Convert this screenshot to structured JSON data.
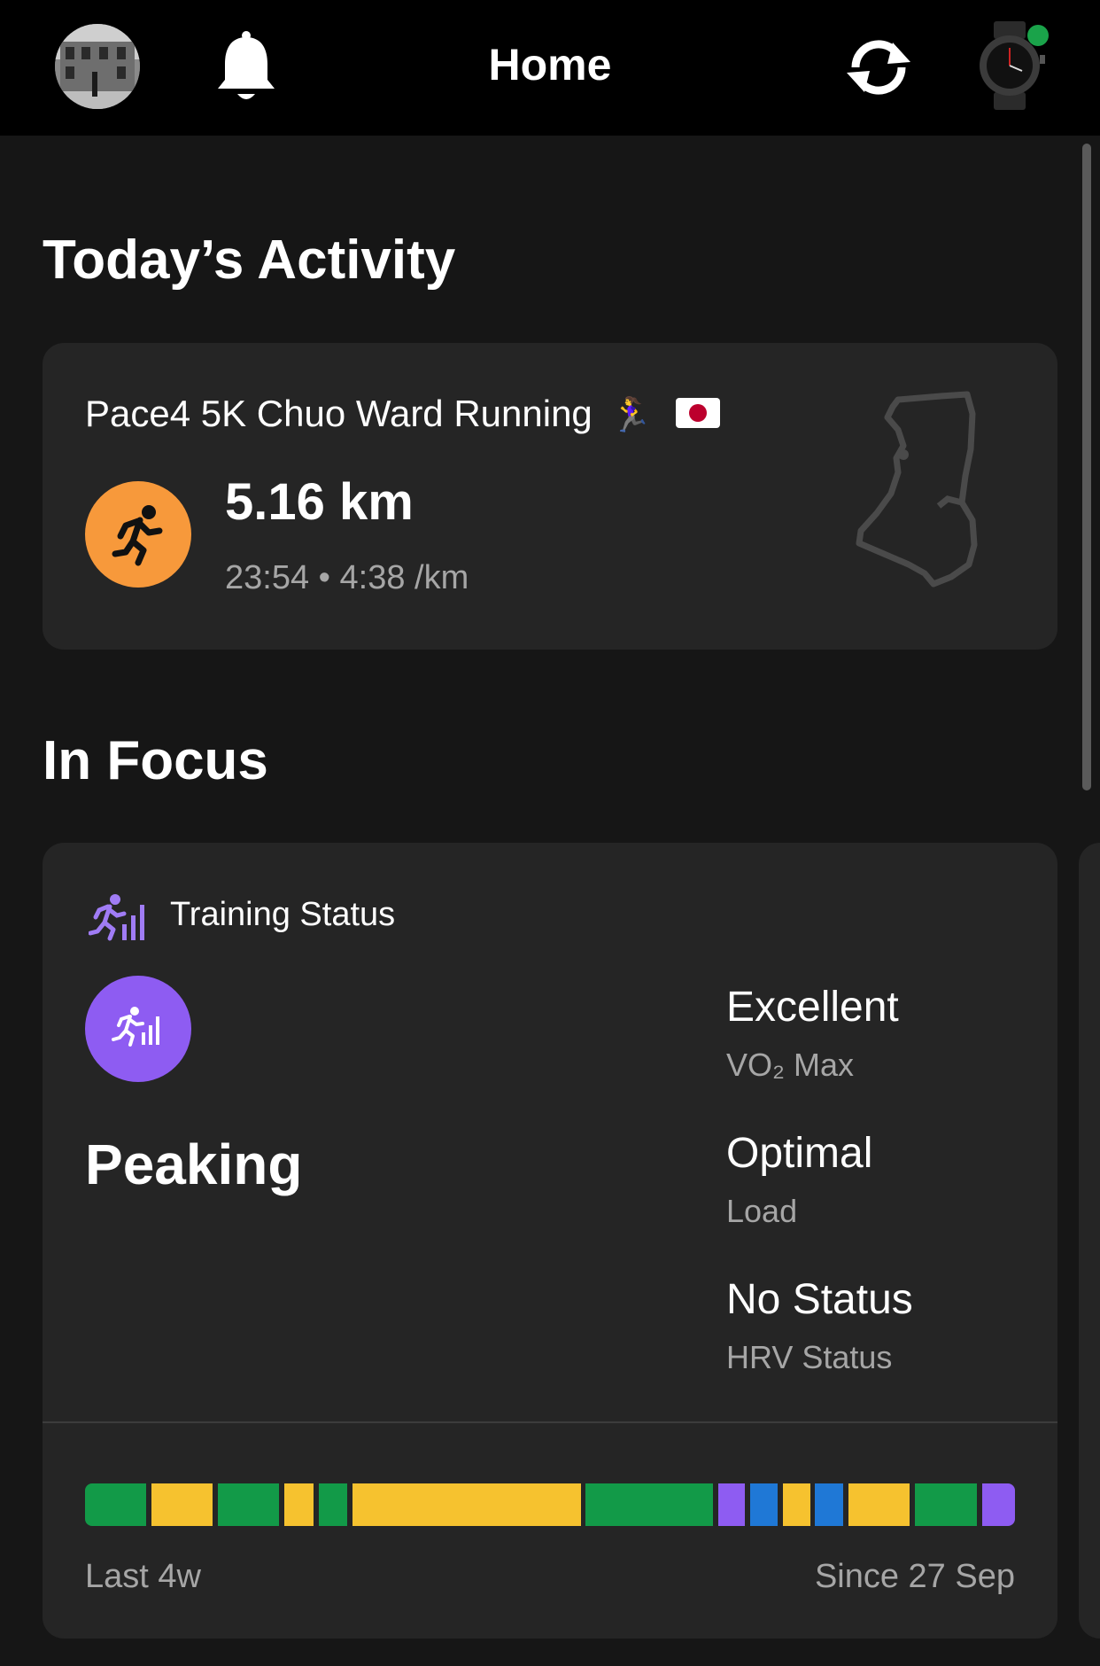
{
  "header": {
    "title": "Home"
  },
  "activity_section": {
    "title": "Today’s Activity",
    "card": {
      "name": "Pace4 5K Chuo Ward Running",
      "name_emoji": "🏃‍♀️",
      "flag_icon": "japan-flag",
      "distance": "5.16 km",
      "summary": "23:54 • 4:38 /km",
      "icon": "running-icon",
      "icon_color": "#f7993b"
    }
  },
  "focus_section": {
    "title": "In Focus",
    "card": {
      "label": "Training Status",
      "status": "Peaking",
      "status_color": "#8e5cf2",
      "metrics": [
        {
          "value": "Excellent",
          "label": "VO₂ Max"
        },
        {
          "value": "Optimal",
          "label": "Load"
        },
        {
          "value": "No Status",
          "label": "HRV Status"
        }
      ],
      "timeline_colors": [
        "#129a48",
        "#f6c22f",
        "#129a48",
        "#f6c22f",
        "#129a48",
        "#f6c22f",
        "#129a48",
        "#8e5cf2",
        "#1f78d6",
        "#f6c22f",
        "#1f78d6",
        "#f6c22f",
        "#129a48",
        "#8e5cf2"
      ],
      "footer_left": "Last 4w",
      "footer_right": "Since 27 Sep"
    }
  }
}
